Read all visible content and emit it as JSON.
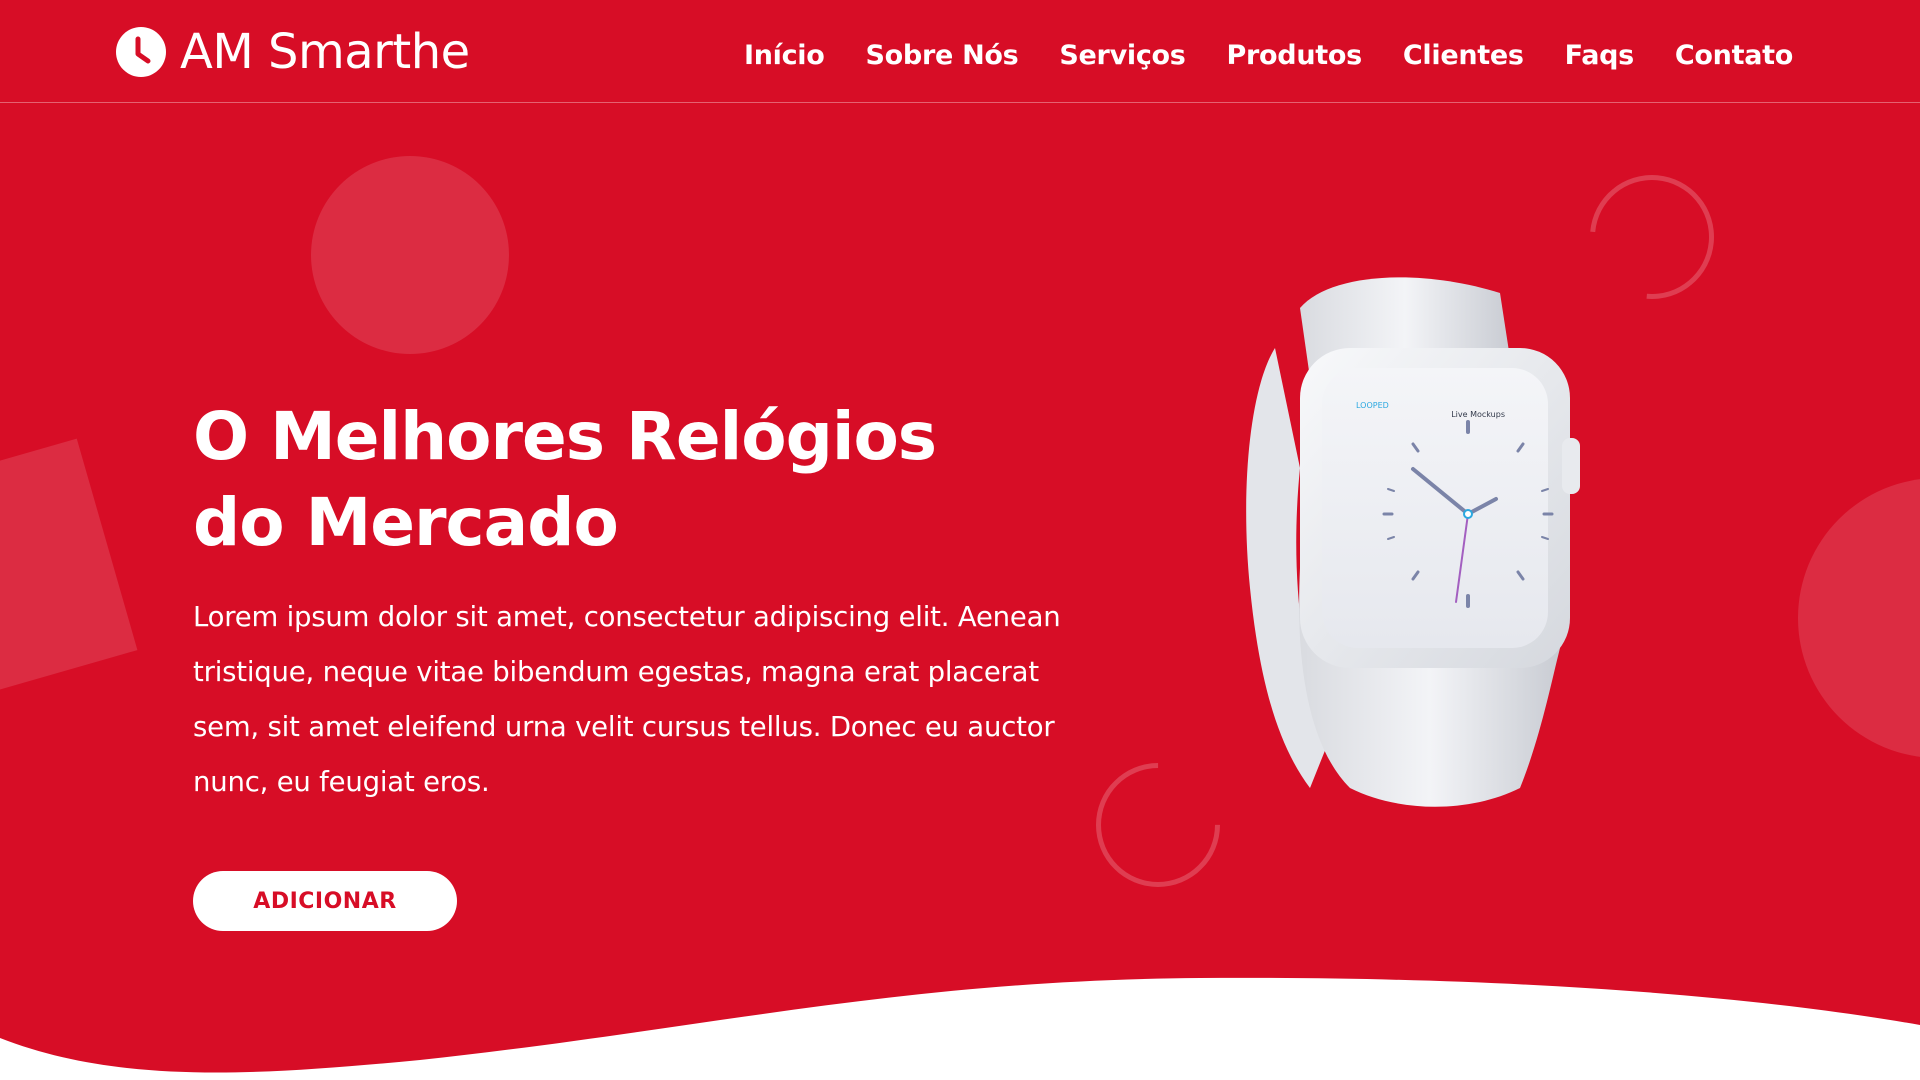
{
  "brand": {
    "name": "AM Smarthe",
    "logo_icon": "clock-icon"
  },
  "nav": {
    "items": [
      {
        "label": "Início"
      },
      {
        "label": "Sobre Nós"
      },
      {
        "label": "Serviços"
      },
      {
        "label": "Produtos"
      },
      {
        "label": "Clientes"
      },
      {
        "label": "Faqs"
      },
      {
        "label": "Contato"
      }
    ]
  },
  "hero": {
    "title_line1": "O Melhores Relógios",
    "title_line2": "do Mercado",
    "description": "Lorem ipsum dolor sit amet, consectetur adipiscing elit. Aenean tristique, neque vitae bibendum egestas, magna erat placerat sem, sit amet eleifend urna velit cursus tellus. Donec eu auctor nunc, eu feugiat eros.",
    "cta_label": "ADICIONAR"
  },
  "product": {
    "image": "white-smartwatch",
    "screen_label_left": "LOOPED",
    "screen_label_right": "Live Mockups"
  },
  "colors": {
    "primary": "#d70d26",
    "text_on_primary": "#ffffff"
  }
}
